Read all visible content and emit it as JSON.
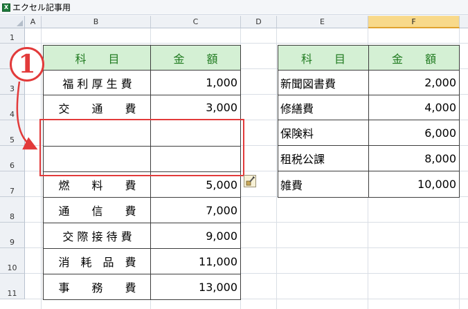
{
  "window": {
    "title": "エクセル記事用",
    "app_icon": "excel-icon"
  },
  "columns": [
    {
      "id": "A",
      "label": "A"
    },
    {
      "id": "B",
      "label": "B"
    },
    {
      "id": "C",
      "label": "C"
    },
    {
      "id": "D",
      "label": "D"
    },
    {
      "id": "E",
      "label": "E"
    },
    {
      "id": "F",
      "label": "F"
    }
  ],
  "selected_column": "F",
  "rows": [
    "1",
    "2",
    "3",
    "4",
    "5",
    "6",
    "7",
    "8",
    "9",
    "10",
    "11"
  ],
  "left_table": {
    "header": {
      "subject": "科　　目",
      "amount": "金　　額"
    },
    "items": [
      {
        "subject": "福 利 厚 生 費",
        "amount": "1,000"
      },
      {
        "subject": "交　　通　　費",
        "amount": "3,000"
      },
      {
        "subject": "",
        "amount": ""
      },
      {
        "subject": "",
        "amount": ""
      },
      {
        "subject": "燃　　料　　費",
        "amount": "5,000"
      },
      {
        "subject": "通　　信　　費",
        "amount": "7,000"
      },
      {
        "subject": "交 際 接 待 費",
        "amount": "9,000"
      },
      {
        "subject": "消　耗　品　費",
        "amount": "11,000"
      },
      {
        "subject": "事　　務　　費",
        "amount": "13,000"
      }
    ]
  },
  "right_table": {
    "header": {
      "subject": "科　　目",
      "amount": "金　　額"
    },
    "items": [
      {
        "subject": "新聞図書費",
        "amount": "2,000"
      },
      {
        "subject": "修繕費",
        "amount": "4,000"
      },
      {
        "subject": "保険料",
        "amount": "6,000"
      },
      {
        "subject": "租税公課",
        "amount": "8,000"
      },
      {
        "subject": "雑費",
        "amount": "10,000"
      }
    ]
  },
  "annotation": {
    "step_number": "1",
    "color": "#e23a3a"
  },
  "paste_options_icon": "paste-options-icon",
  "colors": {
    "header_fill": "#d4f0d4",
    "header_text": "#1f7a1f",
    "selected_column": "#f8d98a"
  }
}
